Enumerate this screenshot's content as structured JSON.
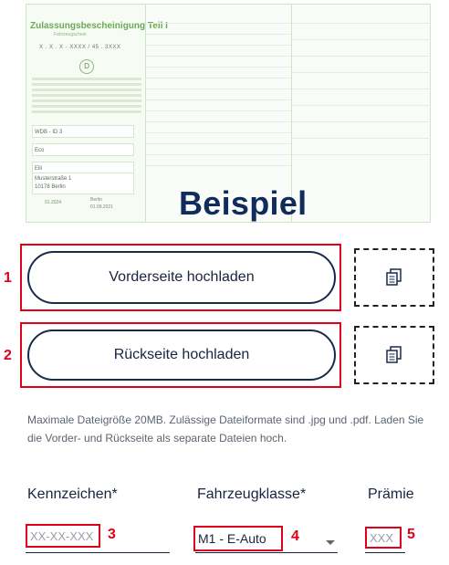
{
  "preview": {
    "doc_title": "Zulassungsbescheinigung Teil I",
    "doc_subtitle": "Fahrzeugschein",
    "doc_code": "X . X . X - XXXX / 45 . 3XXX",
    "doc_d": "D",
    "doc_vin_box": "WDB - ID 3",
    "doc_name1": "Eco",
    "doc_name2": "Elli",
    "doc_address": "Musterstraße 1\n10178 Berlin",
    "doc_date": "01.2024",
    "doc_city": "Berlin",
    "doc_city_date": "01.09.2021",
    "example_label": "Beispiel"
  },
  "uploads": [
    {
      "marker": "1",
      "label": "Vorderseite hochladen",
      "icon": "copy-icon"
    },
    {
      "marker": "2",
      "label": "Rückseite hochladen",
      "icon": "copy-icon"
    }
  ],
  "info": {
    "text": "Maximale Dateigröße 20MB. Zulässige Dateiformate sind .jpg und .pdf. Laden Sie die Vorder- und Rückseite als separate Dateien hoch."
  },
  "form": {
    "kennzeichen": {
      "label": "Kennzeichen*",
      "placeholder": "XX-XX-XXX",
      "marker": "3"
    },
    "fahrzeugklasse": {
      "label": "Fahrzeugklasse*",
      "value": "M1 - E-Auto",
      "marker": "4"
    },
    "praemie": {
      "label": "Prämie",
      "placeholder": "XXX",
      "marker": "5"
    }
  },
  "colors": {
    "accent_red": "#e0001b",
    "navy": "#0f2c5a",
    "doc_green": "#6aaa53"
  }
}
